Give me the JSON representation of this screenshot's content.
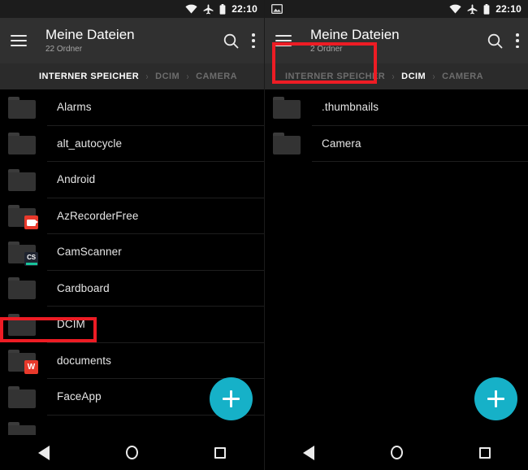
{
  "status_bar": {
    "time": "22:10",
    "icons_right": [
      "wifi-icon",
      "airplane-mode-icon",
      "battery-icon"
    ],
    "photo_icon_right_panel": "photo-icon"
  },
  "accent_colors": {
    "fab": "#16b1c8",
    "highlight_box": "#ed1c24",
    "appbar_bg": "#303030",
    "breadcrumb_bg": "#2b2b2b",
    "list_bg": "#000000"
  },
  "panels": [
    {
      "id": "left",
      "appbar": {
        "menu_icon": "hamburger-menu-icon",
        "title": "Meine Dateien",
        "subtitle": "22 Ordner",
        "search_icon": "search-icon",
        "overflow_icon": "kebab-menu-icon"
      },
      "breadcrumb": [
        {
          "label": "INTERNER SPEICHER",
          "active": true
        },
        {
          "label": "DCIM",
          "active": false
        },
        {
          "label": "CAMERA",
          "active": false
        }
      ],
      "breadcrumb_separator": "›",
      "items": [
        {
          "label": "Alarms",
          "badge": null,
          "highlighted": false
        },
        {
          "label": "alt_autocycle",
          "badge": null,
          "highlighted": false
        },
        {
          "label": "Android",
          "badge": null,
          "highlighted": false
        },
        {
          "label": "AzRecorderFree",
          "badge": "az",
          "highlighted": false
        },
        {
          "label": "CamScanner",
          "badge": "cs",
          "badge_text": "CS",
          "highlighted": false
        },
        {
          "label": "Cardboard",
          "badge": null,
          "highlighted": false
        },
        {
          "label": "DCIM",
          "badge": null,
          "highlighted": true
        },
        {
          "label": "documents",
          "badge": "wps",
          "badge_text": "W",
          "highlighted": false
        },
        {
          "label": "FaceApp",
          "badge": null,
          "highlighted": false
        },
        {
          "label": "",
          "badge": null,
          "highlighted": false
        }
      ],
      "fab": {
        "icon": "plus-icon",
        "label": "+"
      }
    },
    {
      "id": "right",
      "appbar": {
        "menu_icon": "hamburger-menu-icon",
        "title": "Meine Dateien",
        "subtitle": "2 Ordner",
        "search_icon": "search-icon",
        "overflow_icon": "kebab-menu-icon"
      },
      "breadcrumb": [
        {
          "label": "INTERNER SPEICHER",
          "active": false
        },
        {
          "label": "DCIM",
          "active": true
        },
        {
          "label": "CAMERA",
          "active": false
        }
      ],
      "breadcrumb_separator": "›",
      "items": [
        {
          "label": ".thumbnails",
          "badge": null,
          "highlighted": false
        },
        {
          "label": "Camera",
          "badge": null,
          "highlighted": true
        }
      ],
      "fab": {
        "icon": "plus-icon",
        "label": "+"
      }
    }
  ],
  "nav_bar": {
    "back": "back-triangle-icon",
    "home": "home-circle-icon",
    "recents": "recents-square-icon"
  }
}
